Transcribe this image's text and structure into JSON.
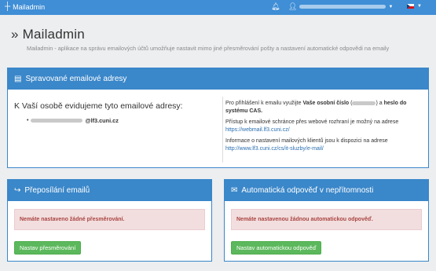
{
  "navbar": {
    "brand": "Mailadmin",
    "brand_icon": "plus-icon",
    "notifications_icon": "bell-icon",
    "user_icon": "person-icon",
    "user_name_redacted": true,
    "language": "cs",
    "accent_color": "#3f8ed6"
  },
  "header": {
    "title": "Mailadmin",
    "subtitle": "Mailadmin - aplikace na správu emailových účtů umožňuje nastavit mimo jiné přesměrování pošty a nastavení automatické odpovědi na emaily"
  },
  "managed": {
    "title": "Spravované emailové adresy",
    "lead": "K Vaší osobě evidujeme tyto emailové adresy:",
    "email_domain": "@lf3.cuni.cz",
    "info_login_pre": "Pro přihlášení k emailu využijte",
    "info_login_bold": "Vaše osobní číslo",
    "info_login_open": " (",
    "info_login_mid": ") a",
    "info_login_bold2": "heslo do systému CAS.",
    "info_web_text": "Přístup k emailové schránce přes webové rozhraní je možný na adrese",
    "info_web_link": "https://webmail.lf3.cuni.cz/",
    "info_settings_text": "Informace o nastavení mailových klientů jsou k dispozici na adrese",
    "info_settings_link": "http://www.lf3.cuni.cz/cs/it-sluzby/e-mail/"
  },
  "forwarding": {
    "title": "Přeposílání emailů",
    "alert": "Nemáte nastaveno žádné přesměrování.",
    "button": "Nastav přesměrování"
  },
  "autoreply": {
    "title": "Automatická odpověď v nepřítomnosti",
    "alert": "Nemáte nastavenou žádnou automatickou odpověď.",
    "button": "Nastav automatickou odpověď"
  }
}
